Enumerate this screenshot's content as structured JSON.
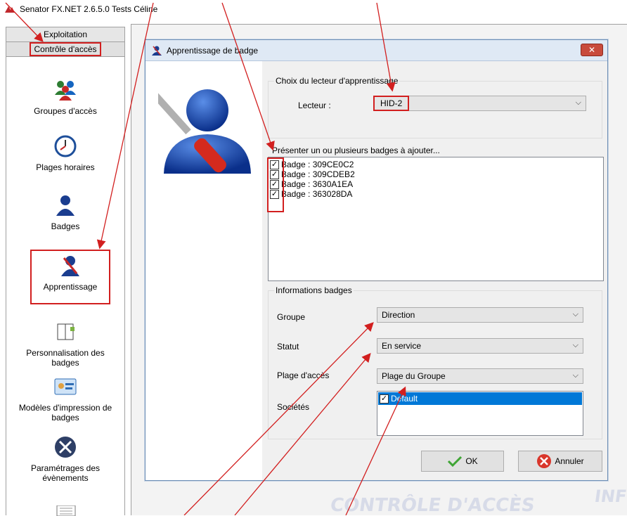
{
  "app": {
    "title": "Senator FX.NET 2.6.5.0 Tests Céline"
  },
  "sidebar": {
    "headers": [
      "Exploitation",
      "Contrôle d'accès"
    ],
    "items": [
      {
        "label": "Groupes d'accès",
        "icon": "users-group-icon"
      },
      {
        "label": "Plages horaires",
        "icon": "clock-icon"
      },
      {
        "label": "Badges",
        "icon": "user-icon"
      },
      {
        "label": "Apprentissage",
        "icon": "user-tool-icon"
      },
      {
        "label": "Personnalisation des badges",
        "icon": "book-icon"
      },
      {
        "label": "Modèles d'impression de badges",
        "icon": "id-card-icon"
      },
      {
        "label": "Paramétrages des évènements",
        "icon": "tools-icon"
      }
    ]
  },
  "dialog": {
    "title": "Apprentissage de badge",
    "close_label": "✕",
    "reader_group": {
      "title": "Choix du lecteur d'apprentissage",
      "label": "Lecteur :",
      "value": "HID-2"
    },
    "badges_group": {
      "title": "Présenter un ou plusieurs badges à ajouter...",
      "badges": [
        {
          "label": "Badge : 309CE0C2",
          "checked": true
        },
        {
          "label": "Badge : 309CDEB2",
          "checked": true
        },
        {
          "label": "Badge : 3630A1EA",
          "checked": true
        },
        {
          "label": "Badge : 363028DA",
          "checked": true
        }
      ]
    },
    "info_group": {
      "title": "Informations badges",
      "groupe_label": "Groupe",
      "groupe_value": "Direction",
      "statut_label": "Statut",
      "statut_value": "En service",
      "plage_label": "Plage d'accès",
      "plage_value": "Plage du Groupe",
      "societes_label": "Sociétés",
      "societes": [
        {
          "label": "Default",
          "checked": true
        }
      ]
    },
    "ok_label": "OK",
    "cancel_label": "Annuler"
  },
  "background": {
    "watermark_1": "CONTRÔLE D'ACCÈS",
    "watermark_2": "INFO"
  },
  "colors": {
    "highlight": "#d21f1f",
    "selection": "#0078d7"
  }
}
